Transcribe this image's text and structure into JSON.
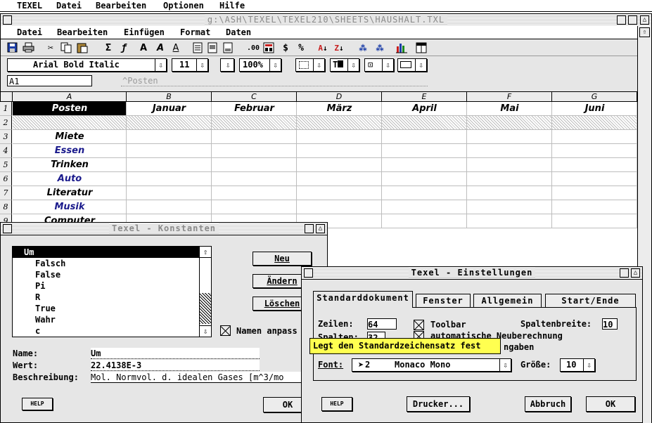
{
  "menubar": {
    "app": "TEXEL",
    "items": [
      "Datei",
      "Bearbeiten",
      "Optionen",
      "Hilfe"
    ]
  },
  "doc_window": {
    "title": "g:\\ASH\\TEXEL\\TEXEL210\\SHEETS\\HAUSHALT.TXL",
    "menu": [
      "Datei",
      "Bearbeiten",
      "Einfügen",
      "Format",
      "Daten"
    ]
  },
  "toolbar": {
    "font_name": "Arial Bold Italic",
    "font_size": "11",
    "zoom": "100%",
    "icons": [
      "save-icon",
      "print-icon",
      "cut-icon",
      "copy-icon",
      "paste-icon",
      "sum-icon",
      "function-icon",
      "bold-icon",
      "italic-icon",
      "outline-icon",
      "page-icon",
      "page-copy-icon",
      "page-edit-icon",
      "decimal-icon",
      "calc-icon",
      "currency-icon",
      "percent-icon",
      "sort-asc-icon",
      "sort-desc-icon",
      "tree-a-icon",
      "tree-b-icon",
      "chart-icon",
      "layout-icon"
    ]
  },
  "formula_bar": {
    "cell_ref": "A1",
    "content": "^Posten"
  },
  "sheet": {
    "columns": [
      "A",
      "B",
      "C",
      "D",
      "E",
      "F",
      "G"
    ],
    "header_row": [
      "Posten",
      "Januar",
      "Februar",
      "März",
      "April",
      "Mai",
      "Juni"
    ],
    "rows": [
      {
        "num": "1"
      },
      {
        "num": "2"
      },
      {
        "num": "3",
        "label": "Miete",
        "color": "#000000"
      },
      {
        "num": "4",
        "label": "Essen",
        "color": "#1a1a8c"
      },
      {
        "num": "5",
        "label": "Trinken",
        "color": "#000000"
      },
      {
        "num": "6",
        "label": "Auto",
        "color": "#1a1a8c"
      },
      {
        "num": "7",
        "label": "Literatur",
        "color": "#000000"
      },
      {
        "num": "8",
        "label": "Musik",
        "color": "#1a1a8c"
      },
      {
        "num": "9",
        "label": "Computer",
        "color": "#000000"
      }
    ]
  },
  "constants_dialog": {
    "title": "Texel - Konstanten",
    "list": [
      "Um",
      "Falsch",
      "False",
      "Pi",
      "R",
      "True",
      "Wahr",
      "c"
    ],
    "selected": "Um",
    "btn_new": "Neu",
    "btn_change": "Ändern",
    "btn_delete": "Löschen",
    "adjust_names_label": "Namen anpass",
    "name_label": "Name:",
    "name_value": "Um",
    "value_label": "Wert:",
    "value_value": "22.4138E-3",
    "desc_label": "Beschreibung:",
    "desc_value": "Mol. Normvol. d. idealen Gases [m^3/mo",
    "help": "HELP",
    "ok": "OK"
  },
  "settings_dialog": {
    "title": "Texel - Einstellungen",
    "tabs": [
      "Standarddokument",
      "Fenster",
      "Allgemein",
      "Start/Ende"
    ],
    "active_tab": "Standarddokument",
    "rows_label": "Zeilen:",
    "rows_value": "64",
    "cols_label": "Spalten:",
    "cols_value": "32",
    "toolbar_check": "Toolbar",
    "auto_calc_check": "automatische Neuberechnung",
    "inputs_tail": "ngaben",
    "col_width_label": "Spaltenbreite:",
    "col_width_value": "10",
    "tooltip": "Legt den Standardzeichensatz fest",
    "font_label": "Font:",
    "font_num": "2",
    "font_value": "Monaco Mono",
    "size_label": "Größe:",
    "size_value": "10",
    "help": "HELP",
    "printer": "Drucker...",
    "cancel": "Abbruch",
    "ok": "OK"
  }
}
